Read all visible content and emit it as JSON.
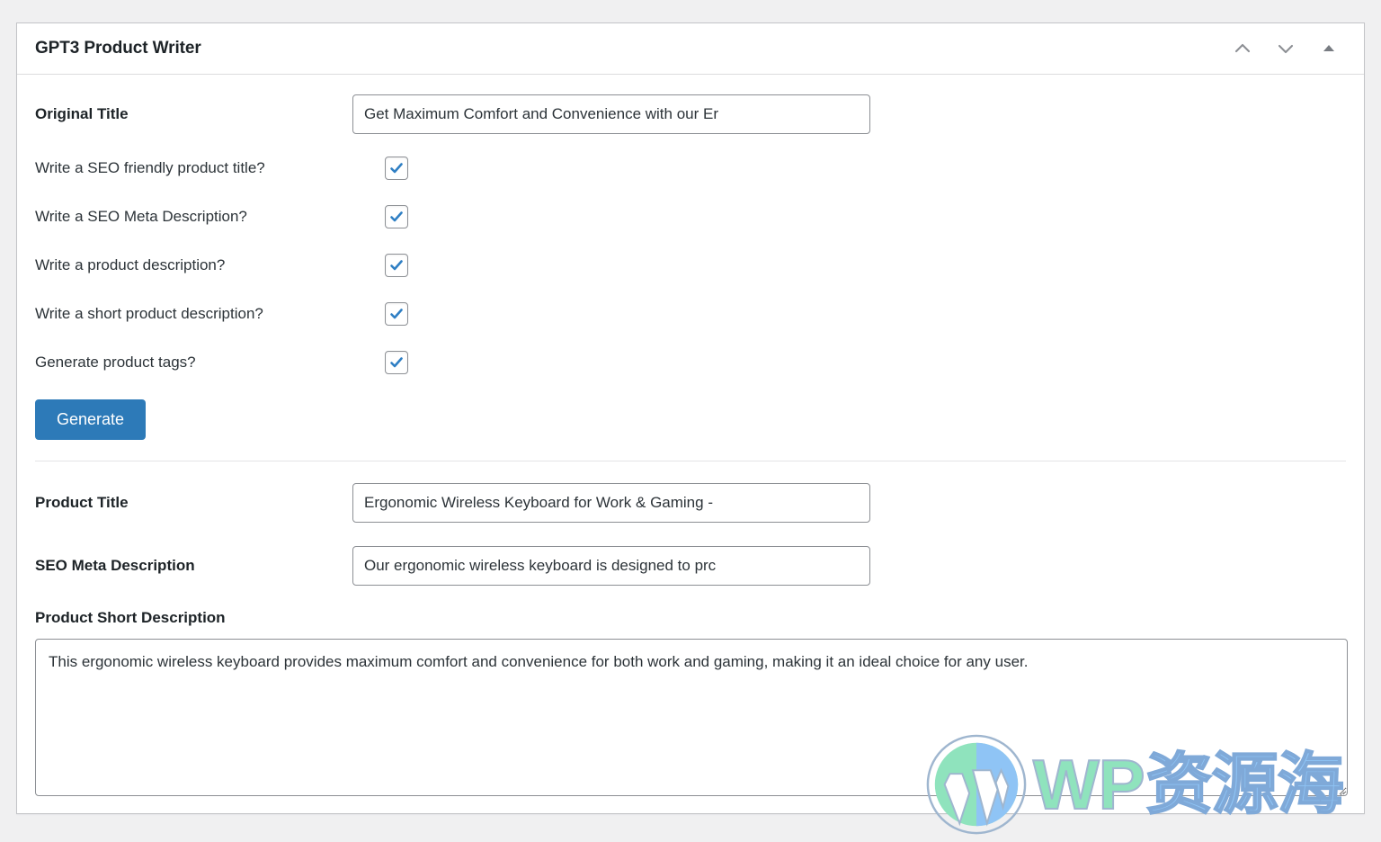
{
  "panel": {
    "title": "GPT3 Product Writer",
    "header_actions": [
      {
        "name": "move-up",
        "icon": "chevron-up-icon",
        "title": "Move up"
      },
      {
        "name": "move-down",
        "icon": "chevron-down-icon",
        "title": "Move down"
      },
      {
        "name": "toggle-panel",
        "icon": "triangle-up-icon",
        "title": "Toggle panel"
      }
    ]
  },
  "form": {
    "original_title": {
      "label": "Original Title",
      "value": "Get Maximum Comfort and Convenience with our Er",
      "placeholder": ""
    },
    "options": [
      {
        "label": "Write a SEO friendly product title?",
        "checked": true
      },
      {
        "label": "Write a SEO Meta Description?",
        "checked": true
      },
      {
        "label": "Write a product description?",
        "checked": true
      },
      {
        "label": "Write a short product description?",
        "checked": true
      },
      {
        "label": "Generate product tags?",
        "checked": true
      }
    ],
    "generate_button": "Generate"
  },
  "results": {
    "product_title": {
      "label": "Product Title",
      "value": "Ergonomic Wireless Keyboard for Work & Gaming -",
      "placeholder": ""
    },
    "seo_meta_description": {
      "label": "SEO Meta Description",
      "value": "Our ergonomic wireless keyboard is designed to prc",
      "placeholder": ""
    },
    "product_short_description": {
      "label": "Product Short Description",
      "value": "This ergonomic wireless keyboard provides maximum comfort and convenience for both work and gaming, making it an ideal choice for any user.",
      "placeholder": ""
    }
  },
  "watermark": {
    "logo": "wordpress-logo-icon",
    "text_en": "WP",
    "text_cn": "资源海"
  },
  "colors": {
    "accent_blue": "#2d7ab8",
    "checkbox_blue": "#2f7fc4",
    "panel_border": "#c3c4c7",
    "page_bg": "#f0f0f1",
    "text": "#1d2327"
  }
}
